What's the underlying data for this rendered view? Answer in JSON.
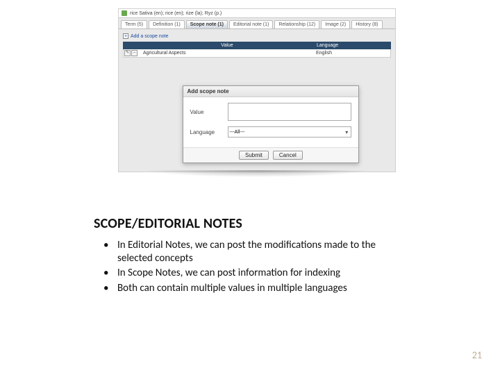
{
  "screenshot": {
    "breadcrumb": "rice Sativa (en); rice (en); rize (la); Ryz (p.)",
    "tabs": [
      {
        "label": "Term (5)"
      },
      {
        "label": "Definition (1)"
      },
      {
        "label": "Scope note (1)",
        "active": true
      },
      {
        "label": "Editorial note (1)"
      },
      {
        "label": "Relationship (12)"
      },
      {
        "label": "Image (2)"
      },
      {
        "label": "History (8)"
      }
    ],
    "add_link": "Add a scope note",
    "grid": {
      "col_value": "Value",
      "col_language": "Language",
      "row_value": "Agricultural Aspects",
      "row_language": "English"
    },
    "modal": {
      "title": "Add scope note",
      "value_label": "Value",
      "language_label": "Language",
      "language_selected": "---All---",
      "submit": "Submit",
      "cancel": "Cancel"
    }
  },
  "heading": "SCOPE/EDITORIAL NOTES",
  "bullets": [
    "In Editorial Notes, we can post the modifications made to the selected concepts",
    "In Scope Notes, we can post information for indexing",
    "Both can contain multiple values in multiple languages"
  ],
  "page_number": "21"
}
